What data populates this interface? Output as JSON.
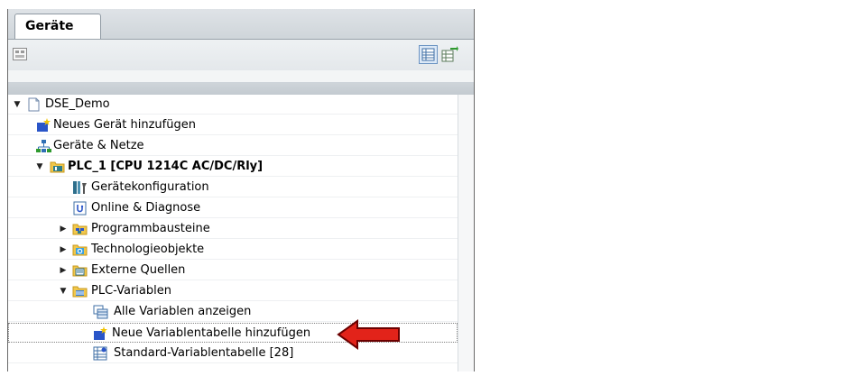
{
  "panel": {
    "tab_label": "Geräte"
  },
  "toolbar": {
    "left_icon": "overview-icon",
    "right_icons": [
      "table-view-icon",
      "export-icon"
    ]
  },
  "tree": {
    "items": [
      {
        "label": "DSE_Demo",
        "icon": "project-file-icon",
        "toggle": "expanded"
      },
      {
        "label": "Neues Gerät hinzufügen",
        "icon": "add-device-icon",
        "toggle": ""
      },
      {
        "label": "Geräte & Netze",
        "icon": "network-icon",
        "toggle": ""
      },
      {
        "label": "PLC_1 [CPU 1214C AC/DC/Rly]",
        "icon": "plc-folder-icon",
        "toggle": "expanded"
      },
      {
        "label": "Gerätekonfiguration",
        "icon": "device-config-icon",
        "toggle": ""
      },
      {
        "label": "Online & Diagnose",
        "icon": "online-diagnosis-icon",
        "toggle": ""
      },
      {
        "label": "Programmbausteine",
        "icon": "program-blocks-folder-icon",
        "toggle": "collapsed"
      },
      {
        "label": "Technologieobjekte",
        "icon": "technology-objects-folder-icon",
        "toggle": "collapsed"
      },
      {
        "label": "Externe Quellen",
        "icon": "external-sources-folder-icon",
        "toggle": "collapsed"
      },
      {
        "label": "PLC-Variablen",
        "icon": "plc-variables-folder-icon",
        "toggle": "expanded"
      },
      {
        "label": "Alle Variablen anzeigen",
        "icon": "show-variables-icon",
        "toggle": ""
      },
      {
        "label": "Neue Variablentabelle hinzufügen",
        "icon": "add-table-icon",
        "toggle": ""
      },
      {
        "label": "Standard-Variablentabelle [28]",
        "icon": "variable-table-icon",
        "toggle": ""
      }
    ]
  },
  "colors": {
    "arrow": "#e2231a",
    "selection_border": "#808080"
  }
}
